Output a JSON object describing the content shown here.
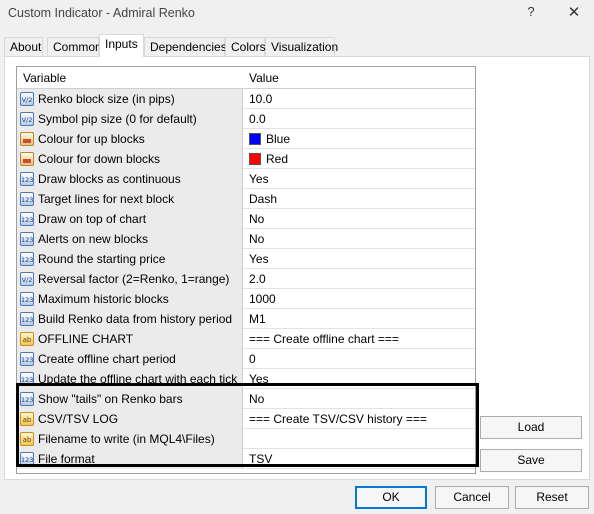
{
  "window": {
    "title": "Custom Indicator - Admiral Renko",
    "help_label": "?",
    "close_label": "✕"
  },
  "tabs": [
    {
      "label": "About"
    },
    {
      "label": "Common"
    },
    {
      "label": "Inputs",
      "active": true
    },
    {
      "label": "Dependencies"
    },
    {
      "label": "Colors"
    },
    {
      "label": "Visualization"
    }
  ],
  "grid": {
    "col_variable": "Variable",
    "col_value": "Value",
    "rows": [
      {
        "icon": "v2",
        "icon_text": "V/2",
        "variable": "Renko block size (in pips)",
        "value": "10.0"
      },
      {
        "icon": "v2",
        "icon_text": "V/2",
        "variable": "Symbol pip size (0 for default)",
        "value": "0.0"
      },
      {
        "icon": "color",
        "icon_text": "",
        "variable": "Colour for up blocks",
        "value": "Blue",
        "swatch": "#0000ff"
      },
      {
        "icon": "color",
        "icon_text": "",
        "variable": "Colour for down blocks",
        "value": "Red",
        "swatch": "#ff0000"
      },
      {
        "icon": "123",
        "icon_text": "123",
        "variable": "Draw blocks as continuous",
        "value": "Yes"
      },
      {
        "icon": "123",
        "icon_text": "123",
        "variable": "Target lines for next block",
        "value": "Dash"
      },
      {
        "icon": "123",
        "icon_text": "123",
        "variable": "Draw on top of chart",
        "value": "No"
      },
      {
        "icon": "123",
        "icon_text": "123",
        "variable": "Alerts on new blocks",
        "value": "No"
      },
      {
        "icon": "123",
        "icon_text": "123",
        "variable": "Round the starting price",
        "value": "Yes"
      },
      {
        "icon": "v2",
        "icon_text": "V/2",
        "variable": "Reversal factor (2=Renko, 1=range)",
        "value": "2.0"
      },
      {
        "icon": "123",
        "icon_text": "123",
        "variable": "Maximum historic blocks",
        "value": "1000"
      },
      {
        "icon": "123",
        "icon_text": "123",
        "variable": "Build Renko data from history period",
        "value": "M1"
      },
      {
        "icon": "ab",
        "icon_text": "ab",
        "variable": "OFFLINE CHART",
        "value": "=== Create offline chart  ==="
      },
      {
        "icon": "123",
        "icon_text": "123",
        "variable": "Create offline chart period",
        "value": "0"
      },
      {
        "icon": "123",
        "icon_text": "123",
        "variable": "Update the offline chart with each tick",
        "value": "Yes"
      },
      {
        "icon": "123",
        "icon_text": "123",
        "variable": "Show \"tails\" on Renko bars",
        "value": "No"
      },
      {
        "icon": "ab",
        "icon_text": "ab",
        "variable": "CSV/TSV LOG",
        "value": "=== Create TSV/CSV history ==="
      },
      {
        "icon": "ab",
        "icon_text": "ab",
        "variable": "Filename to write (in MQL4\\Files)",
        "value": ""
      },
      {
        "icon": "123",
        "icon_text": "123",
        "variable": "File format",
        "value": "TSV"
      }
    ]
  },
  "side_buttons": {
    "load": "Load",
    "save": "Save"
  },
  "footer": {
    "ok": "OK",
    "cancel": "Cancel",
    "reset": "Reset"
  }
}
